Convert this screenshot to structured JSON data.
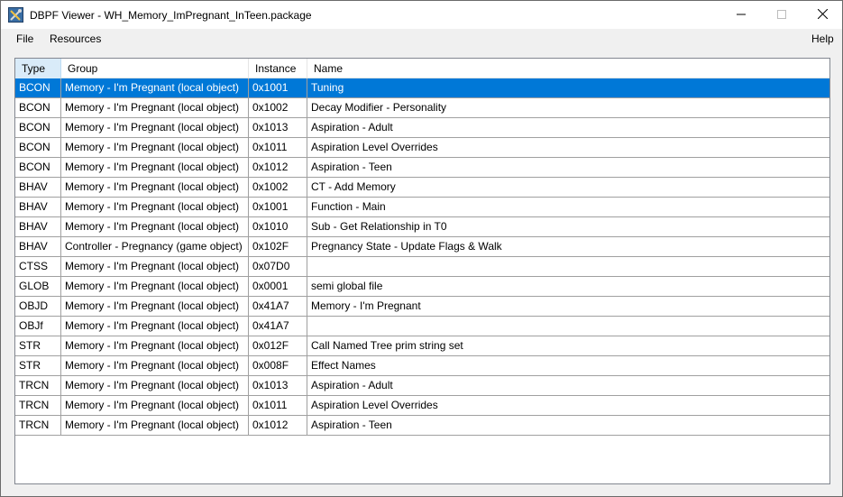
{
  "window": {
    "title": "DBPF Viewer - WH_Memory_ImPregnant_InTeen.package",
    "icon": "tools-app-icon"
  },
  "menu": {
    "file": "File",
    "resources": "Resources",
    "help": "Help"
  },
  "table": {
    "columns": [
      "Type",
      "Group",
      "Instance",
      "Name"
    ],
    "sorted_column": "Type",
    "selected_row": 0,
    "rows": [
      {
        "type": "BCON",
        "group": "Memory - I'm Pregnant (local object)",
        "instance": "0x1001",
        "name": "Tuning"
      },
      {
        "type": "BCON",
        "group": "Memory - I'm Pregnant (local object)",
        "instance": "0x1002",
        "name": "Decay Modifier - Personality"
      },
      {
        "type": "BCON",
        "group": "Memory - I'm Pregnant (local object)",
        "instance": "0x1013",
        "name": "Aspiration - Adult"
      },
      {
        "type": "BCON",
        "group": "Memory - I'm Pregnant (local object)",
        "instance": "0x1011",
        "name": "Aspiration Level Overrides"
      },
      {
        "type": "BCON",
        "group": "Memory - I'm Pregnant (local object)",
        "instance": "0x1012",
        "name": "Aspiration - Teen"
      },
      {
        "type": "BHAV",
        "group": "Memory - I'm Pregnant (local object)",
        "instance": "0x1002",
        "name": "CT - Add Memory"
      },
      {
        "type": "BHAV",
        "group": "Memory - I'm Pregnant (local object)",
        "instance": "0x1001",
        "name": "Function - Main"
      },
      {
        "type": "BHAV",
        "group": "Memory - I'm Pregnant (local object)",
        "instance": "0x1010",
        "name": "Sub - Get Relationship in T0"
      },
      {
        "type": "BHAV",
        "group": "Controller - Pregnancy (game object)",
        "instance": "0x102F",
        "name": "Pregnancy State - Update Flags & Walk"
      },
      {
        "type": "CTSS",
        "group": "Memory - I'm Pregnant (local object)",
        "instance": "0x07D0",
        "name": ""
      },
      {
        "type": "GLOB",
        "group": "Memory - I'm Pregnant (local object)",
        "instance": "0x0001",
        "name": "semi global file"
      },
      {
        "type": "OBJD",
        "group": "Memory - I'm Pregnant (local object)",
        "instance": "0x41A7",
        "name": "Memory - I'm Pregnant"
      },
      {
        "type": "OBJf",
        "group": "Memory - I'm Pregnant (local object)",
        "instance": "0x41A7",
        "name": ""
      },
      {
        "type": "STR",
        "group": "Memory - I'm Pregnant (local object)",
        "instance": "0x012F",
        "name": "Call Named Tree prim string set"
      },
      {
        "type": "STR",
        "group": "Memory - I'm Pregnant (local object)",
        "instance": "0x008F",
        "name": "Effect Names"
      },
      {
        "type": "TRCN",
        "group": "Memory - I'm Pregnant (local object)",
        "instance": "0x1013",
        "name": "Aspiration - Adult"
      },
      {
        "type": "TRCN",
        "group": "Memory - I'm Pregnant (local object)",
        "instance": "0x1011",
        "name": "Aspiration Level Overrides"
      },
      {
        "type": "TRCN",
        "group": "Memory - I'm Pregnant (local object)",
        "instance": "0x1012",
        "name": "Aspiration - Teen"
      }
    ]
  },
  "colors": {
    "selection": "#0078d7",
    "sorted_header": "#d9ebf9",
    "grid": "#a0a0a0"
  }
}
